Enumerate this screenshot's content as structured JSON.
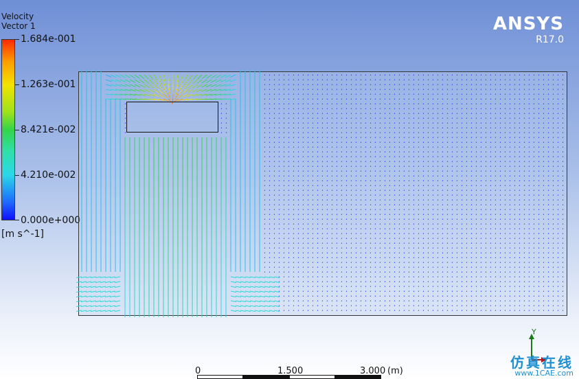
{
  "legend": {
    "variable": "Velocity",
    "object": "Vector 1",
    "ticks": [
      "1.684e-001",
      "1.263e-001",
      "8.421e-002",
      "4.210e-002",
      "0.000e+000"
    ],
    "units": "[m s^-1]"
  },
  "brand": {
    "name": "ANSYS",
    "version": "R17.0"
  },
  "scale": {
    "labels": [
      "0",
      "1.500",
      "3.000"
    ],
    "unit": "(m)"
  },
  "axis_triad": {
    "y_label": "Y"
  },
  "watermark": {
    "text": "仿真在线",
    "url": "www.1CAE.com"
  },
  "colors": {
    "max": "#ff2a00",
    "mid": "#34d44a",
    "min": "#1010ff",
    "background_top": "#6f8fd6"
  },
  "icons": {
    "axis": "axis-triad-icon"
  }
}
